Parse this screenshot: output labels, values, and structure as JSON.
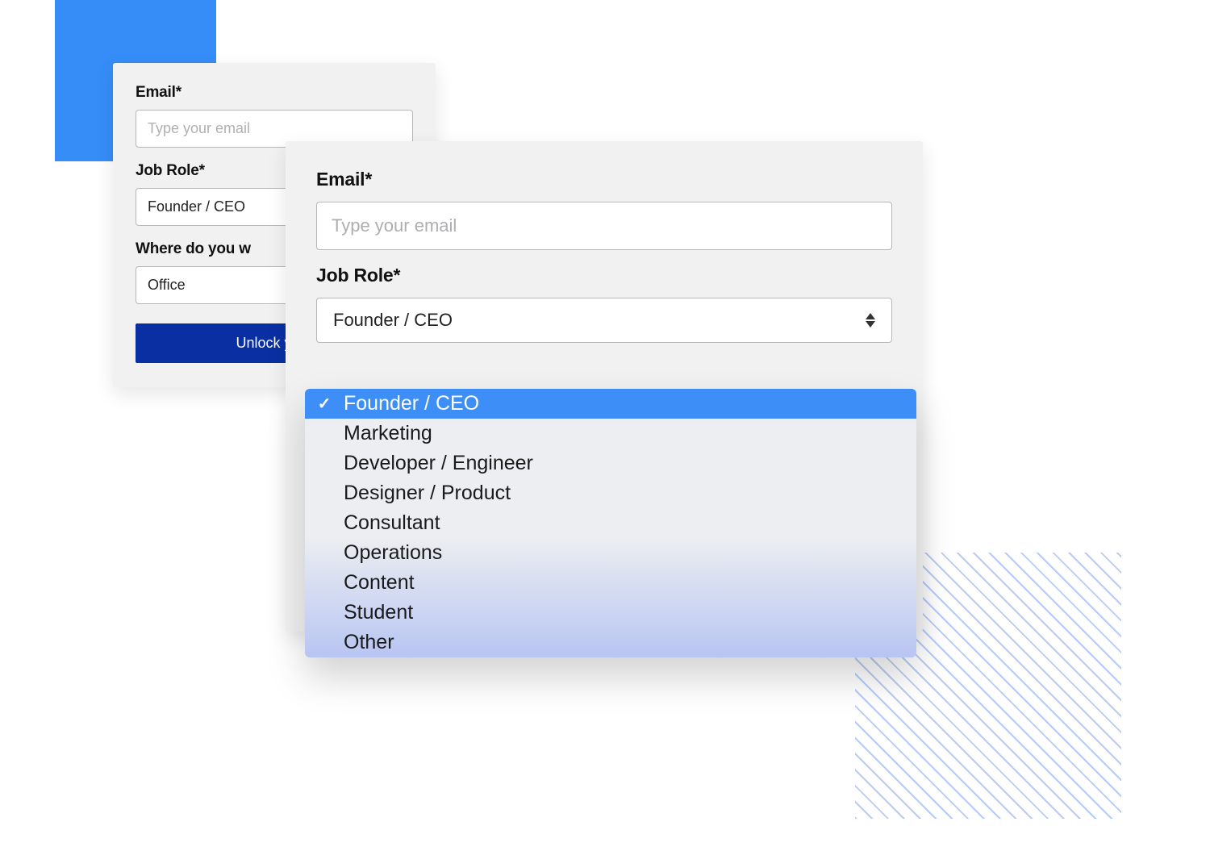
{
  "back_form": {
    "email_label": "Email*",
    "email_placeholder": "Type your email",
    "job_role_label": "Job Role*",
    "job_role_value": "Founder / CEO",
    "work_location_label": "Where do you w",
    "work_location_value": "Office",
    "submit_label": "Unlock your"
  },
  "front_form": {
    "email_label": "Email*",
    "email_placeholder": "Type your email",
    "job_role_label": "Job Role*",
    "job_role_value": "Founder / CEO"
  },
  "job_role_options": [
    {
      "label": "Founder / CEO",
      "selected": true
    },
    {
      "label": "Marketing",
      "selected": false
    },
    {
      "label": "Developer / Engineer",
      "selected": false
    },
    {
      "label": "Designer / Product",
      "selected": false
    },
    {
      "label": "Consultant",
      "selected": false
    },
    {
      "label": "Operations",
      "selected": false
    },
    {
      "label": "Content",
      "selected": false
    },
    {
      "label": "Student",
      "selected": false
    },
    {
      "label": "Other",
      "selected": false
    }
  ],
  "colors": {
    "accent_blue": "#368df7",
    "primary_button": "#0a2fa3",
    "option_hover": "#3d8ff7"
  }
}
